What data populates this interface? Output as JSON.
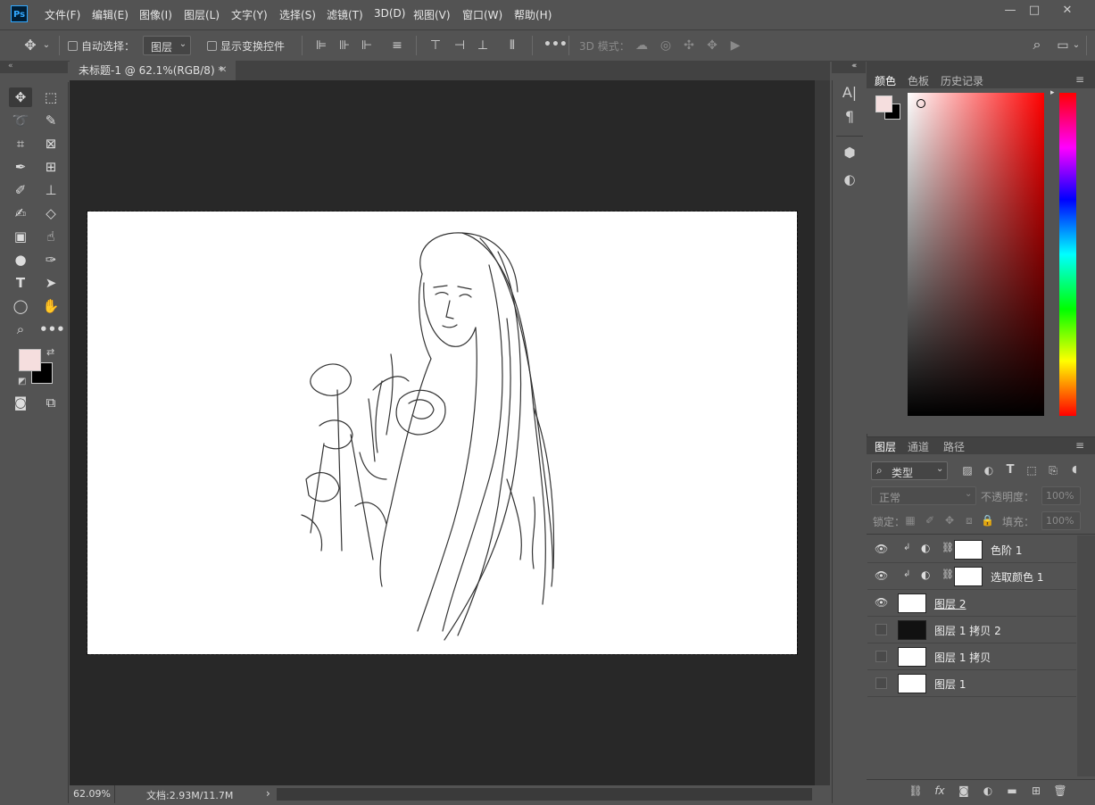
{
  "app": {
    "logo": "Ps"
  },
  "menu": [
    "文件(F)",
    "编辑(E)",
    "图像(I)",
    "图层(L)",
    "文字(Y)",
    "选择(S)",
    "滤镜(T)",
    "3D(D)",
    "视图(V)",
    "窗口(W)",
    "帮助(H)"
  ],
  "window_buttons": {
    "minimize": "—",
    "restore": "□",
    "close": "✕"
  },
  "options": {
    "auto_select_label": "自动选择：",
    "auto_select_value": "图层",
    "show_transform_label": "显示变换控件",
    "mode_3d_label": "3D 模式："
  },
  "document": {
    "tab_title": "未标题-1 @ 62.1%(RGB/8) *",
    "close_glyph": "✕",
    "zoom": "62.09%",
    "doc_size": "文档:2.93M/11.7M",
    "status_arrow": "›"
  },
  "color_panel": {
    "tabs": [
      "颜色",
      "色板",
      "历史记录"
    ],
    "foreground": "#f5dede",
    "background": "#000000"
  },
  "layers_panel": {
    "tabs": [
      "图层",
      "通道",
      "路径"
    ],
    "filter_label": "类型",
    "blend_mode": "正常",
    "opacity_label": "不透明度：",
    "opacity_value": "100%",
    "lock_label": "锁定：",
    "fill_label": "填充：",
    "fill_value": "100%",
    "layers": [
      {
        "name": "色阶 1",
        "visible": true,
        "adjustment": true
      },
      {
        "name": "选取颜色 1",
        "visible": true,
        "adjustment": true
      },
      {
        "name": "图层 2",
        "visible": true,
        "adjustment": false
      },
      {
        "name": "图层 1 拷贝 2",
        "visible": false,
        "adjustment": false
      },
      {
        "name": "图层 1 拷贝",
        "visible": false,
        "adjustment": false
      },
      {
        "name": "图层 1",
        "visible": false,
        "adjustment": false
      }
    ],
    "footer_icons": [
      "link-icon",
      "fx-icon",
      "mask-icon",
      "adjustment-icon",
      "folder-icon",
      "new-layer-icon",
      "trash-icon"
    ]
  }
}
